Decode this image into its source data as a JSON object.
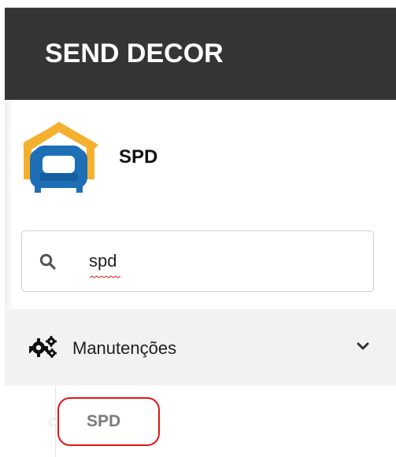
{
  "header": {
    "brand": "SEND DECOR"
  },
  "profile": {
    "name": "SPD",
    "logo_icon": "armchair-house-logo"
  },
  "search": {
    "value": "spd",
    "placeholder": "",
    "icon": "search-icon",
    "spellcheck_underline_color": "#e02020"
  },
  "menu": {
    "group_label": "Manutenções",
    "group_icon": "gears-icon",
    "chevron_icon": "chevron-down-icon",
    "items": [
      {
        "label": "SPD",
        "highlight_color": "#e01515"
      }
    ]
  },
  "colors": {
    "header_background": "#353535",
    "menu_group_background": "#f2f2f2",
    "logo_orange": "#f5b02f",
    "logo_blue": "#1f6fb6"
  }
}
